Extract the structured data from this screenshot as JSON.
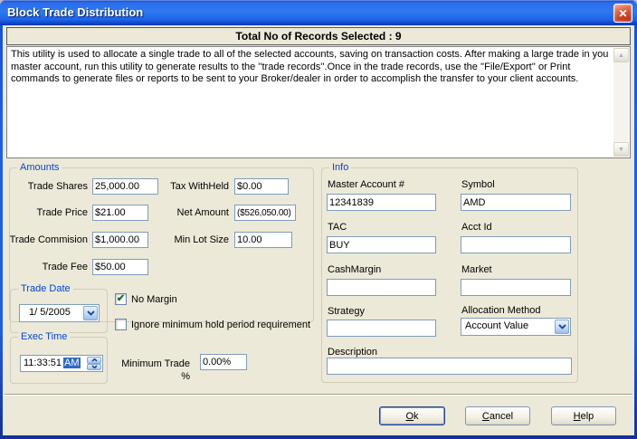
{
  "window": {
    "title": "Block Trade Distribution"
  },
  "header": {
    "text": "Total No of Records Selected : 9"
  },
  "description": {
    "text": "This utility is used to allocate a single trade to all of the selected accounts, saving on transaction costs. After making a large trade in you master account, run this utility to generate results to the ''trade records''.Once in the trade records, use the ''File/Export'' or Print commands to generate files or reports to be sent to your Broker/dealer in order to accomplish the transfer to your client accounts."
  },
  "icons": {
    "close": "✕",
    "checked": "✔",
    "scroll_up": "▲",
    "scroll_down": "▼"
  },
  "colors": {
    "titlebar_blue": "#2e79f2",
    "selection_blue": "#316ac5",
    "group_label_blue": "#0046d5",
    "check_green": "#156c15",
    "close_red": "#cc4325"
  },
  "amounts": {
    "legend": "Amounts",
    "fields": {
      "trade_shares": {
        "label": "Trade Shares",
        "value": "25,000.00"
      },
      "tax_withheld": {
        "label": "Tax WithHeld",
        "value": "$0.00"
      },
      "trade_price": {
        "label": "Trade Price",
        "value": "$21.00"
      },
      "net_amount": {
        "label": "Net Amount",
        "value": "($526,050.00)"
      },
      "trade_commision": {
        "label": "Trade Commision",
        "value": "$1,000.00"
      },
      "min_lot_size": {
        "label": "Min Lot Size",
        "value": "10.00"
      },
      "trade_fee": {
        "label": "Trade Fee",
        "value": "$50.00"
      }
    }
  },
  "trade_date": {
    "legend": "Trade Date",
    "value": "1/ 5/2005"
  },
  "exec_time": {
    "legend": "Exec Time",
    "time": "11:33:51",
    "meridiem": "AM"
  },
  "checkboxes": {
    "no_margin": {
      "label": "No Margin",
      "checked": true
    },
    "ignore_min_hold": {
      "label": "Ignore minimum hold period requirement",
      "checked": false
    }
  },
  "minimum_trade": {
    "label": "Minimum Trade %",
    "value": "0.00%"
  },
  "info": {
    "legend": "Info",
    "master_account": {
      "label": "Master Account #",
      "value": "12341839"
    },
    "symbol": {
      "label": "Symbol",
      "value": "AMD"
    },
    "tac": {
      "label": "TAC",
      "value": "BUY"
    },
    "acct_id": {
      "label": "Acct Id",
      "value": ""
    },
    "cash_margin": {
      "label": "CashMargin",
      "value": ""
    },
    "market": {
      "label": "Market",
      "value": ""
    },
    "strategy": {
      "label": "Strategy",
      "value": ""
    },
    "allocation_method": {
      "label": "Allocation Method",
      "value": "Account Value"
    },
    "description": {
      "label": "Description",
      "value": ""
    }
  },
  "buttons": {
    "ok": "Ok",
    "cancel": "Cancel",
    "help": "Help"
  }
}
